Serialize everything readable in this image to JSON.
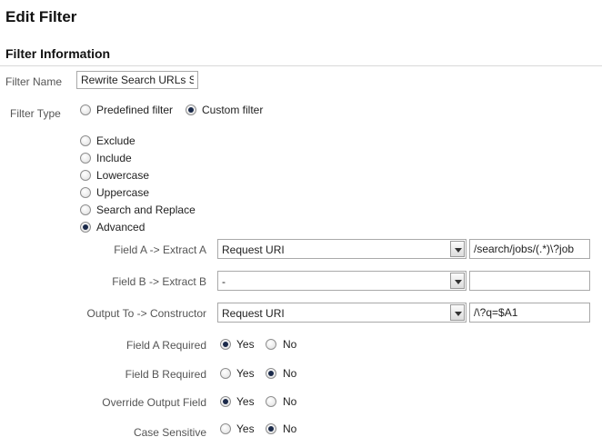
{
  "page": {
    "title": "Edit Filter",
    "section_title": "Filter Information"
  },
  "filter_name": {
    "label": "Filter Name",
    "value": "Rewrite Search URLs S"
  },
  "filter_type": {
    "label": "Filter Type",
    "options": [
      {
        "label": "Predefined filter",
        "selected": false
      },
      {
        "label": "Custom filter",
        "selected": true
      }
    ]
  },
  "custom_types": [
    {
      "label": "Exclude",
      "selected": false
    },
    {
      "label": "Include",
      "selected": false
    },
    {
      "label": "Lowercase",
      "selected": false
    },
    {
      "label": "Uppercase",
      "selected": false
    },
    {
      "label": "Search and Replace",
      "selected": false
    },
    {
      "label": "Advanced",
      "selected": true
    }
  ],
  "advanced": {
    "field_a": {
      "label": "Field A -> Extract A",
      "select_value": "Request URI",
      "input_value": "/search/jobs/(.*)\\?job"
    },
    "field_b": {
      "label": "Field B -> Extract B",
      "select_value": "-",
      "input_value": ""
    },
    "output": {
      "label": "Output To -> Constructor",
      "select_value": "Request URI",
      "input_value": "/\\?q=$A1"
    },
    "toggles": [
      {
        "label": "Field A Required",
        "yes_label": "Yes",
        "no_label": "No",
        "value": "yes"
      },
      {
        "label": "Field B Required",
        "yes_label": "Yes",
        "no_label": "No",
        "value": "no"
      },
      {
        "label": "Override Output Field",
        "yes_label": "Yes",
        "no_label": "No",
        "value": "yes"
      },
      {
        "label": "Case Sensitive",
        "yes_label": "Yes",
        "no_label": "No",
        "value": "no"
      }
    ]
  }
}
